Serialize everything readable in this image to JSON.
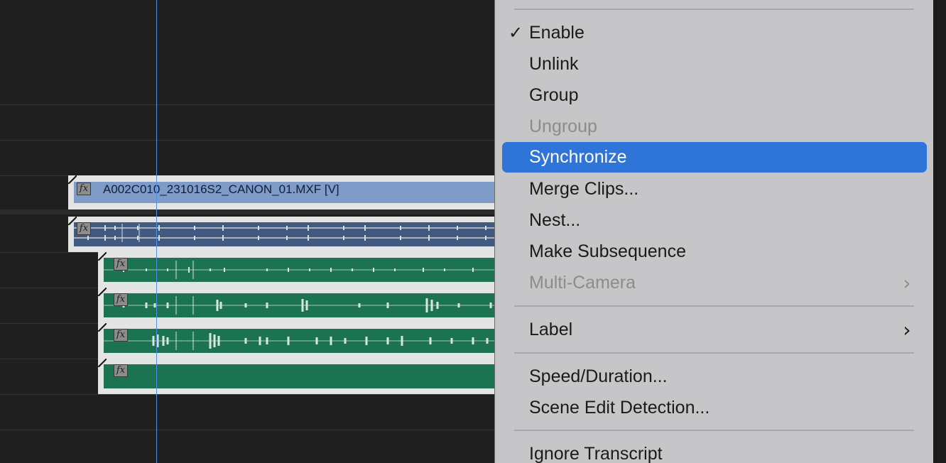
{
  "timeline": {
    "video_clip": {
      "name": "A002C010_231016S2_CANON_01.MXF [V]",
      "fx": "fx"
    },
    "linked_audio_clip": {
      "fx": "fx"
    },
    "audio_clips": [
      {
        "fx": "fx"
      },
      {
        "fx": "fx"
      },
      {
        "fx": "fx"
      },
      {
        "fx": "fx"
      }
    ],
    "colors": {
      "video": "#7f9cc9",
      "linked_audio": "#425a80",
      "audio": "#1c7352",
      "playhead": "#4f8fe6"
    }
  },
  "context_menu": {
    "items": [
      {
        "label": "Enable",
        "checked": true,
        "check_glyph": "✓",
        "state": "normal"
      },
      {
        "label": "Unlink",
        "state": "normal"
      },
      {
        "label": "Group",
        "state": "normal"
      },
      {
        "label": "Ungroup",
        "state": "disabled"
      },
      {
        "label": "Synchronize",
        "state": "highlighted"
      },
      {
        "label": "Merge Clips...",
        "state": "normal"
      },
      {
        "label": "Nest...",
        "state": "normal"
      },
      {
        "label": "Make Subsequence",
        "state": "normal"
      },
      {
        "label": "Multi-Camera",
        "state": "disabled",
        "submenu": true,
        "arrow_glyph": "›"
      },
      {
        "label": "Label",
        "state": "normal",
        "submenu": true,
        "arrow_glyph": "›"
      },
      {
        "label": "Speed/Duration...",
        "state": "normal"
      },
      {
        "label": "Scene Edit Detection...",
        "state": "normal"
      },
      {
        "label": "Ignore Transcript",
        "state": "normal"
      }
    ],
    "highlight_color": "#2f74d8"
  }
}
